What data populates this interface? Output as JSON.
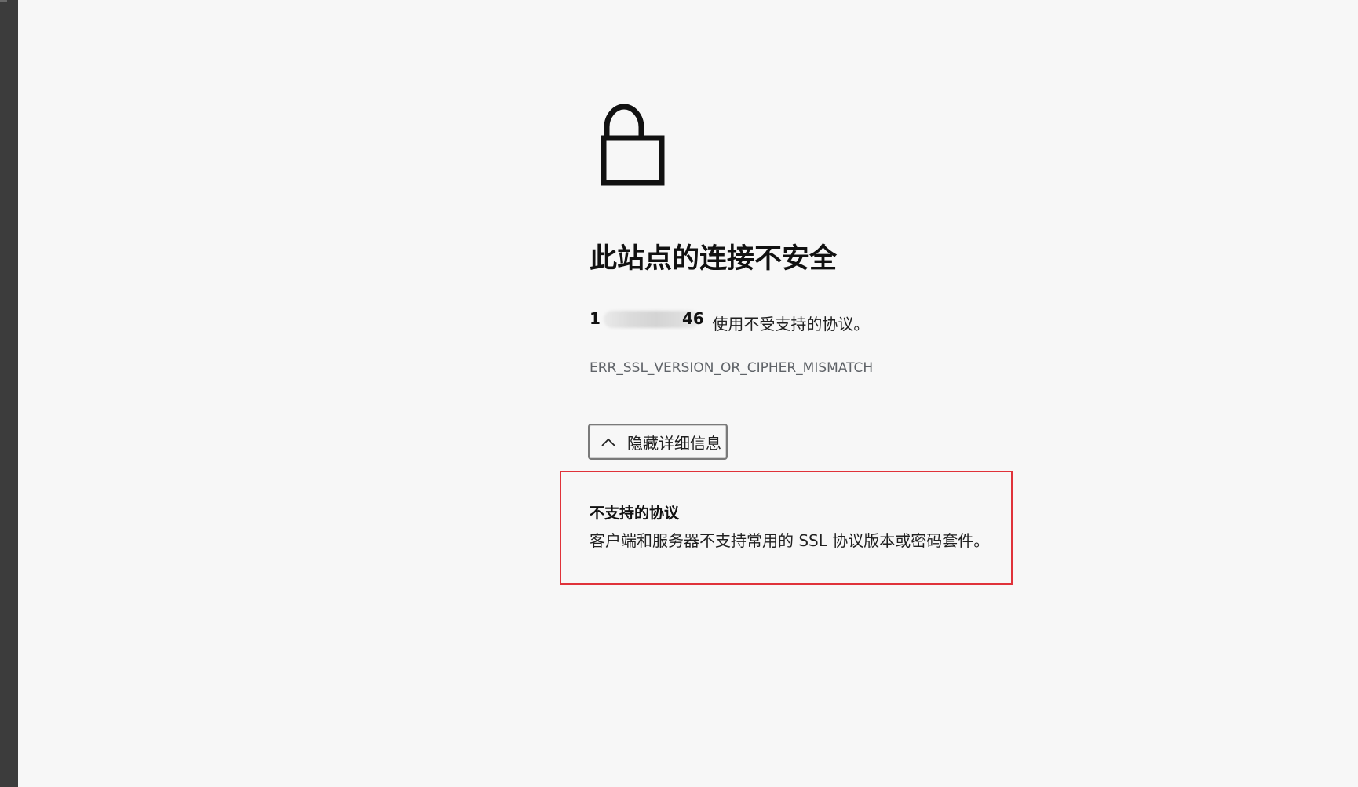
{
  "page": {
    "heading": "此站点的连接不安全",
    "host_visible_prefix": "1",
    "host_visible_suffix": "46",
    "message_suffix": " 使用不受支持的协议。",
    "error_code": "ERR_SSL_VERSION_OR_CIPHER_MISMATCH",
    "details_button_label": "隐藏详细信息",
    "details": {
      "title": "不支持的协议",
      "text": "客户端和服务器不支持常用的 SSL 协议版本或密码套件。"
    }
  },
  "icons": {
    "lock": "unlocked-padlock-icon",
    "chevron": "chevron-up-icon"
  },
  "colors": {
    "background": "#f7f7f7",
    "highlight_border": "#e0323a",
    "left_bar": "#3c3c3c",
    "error_code_text": "#5f6368"
  }
}
